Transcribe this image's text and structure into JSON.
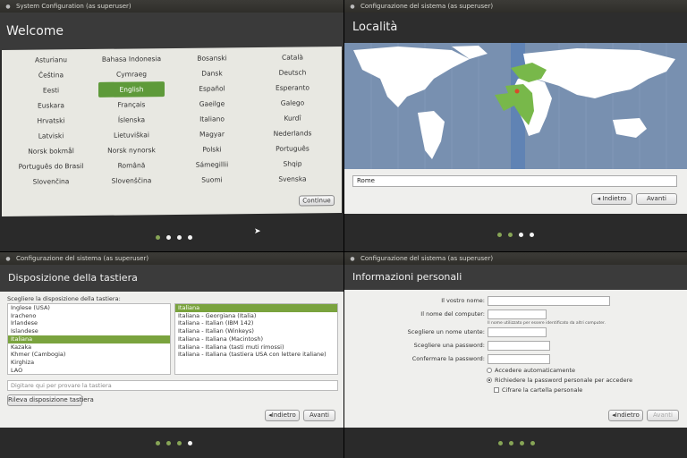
{
  "panel1": {
    "window_title": "System Configuration (as superuser)",
    "heading": "Welcome",
    "languages": [
      "Asturianu",
      "Bahasa Indonesia",
      "Bosanski",
      "Català",
      "Čeština",
      "Cymraeg",
      "Dansk",
      "Deutsch",
      "Eesti",
      "English",
      "Español",
      "Esperanto",
      "Euskara",
      "Français",
      "Gaeilge",
      "Galego",
      "Hrvatski",
      "Íslenska",
      "Italiano",
      "Kurdî",
      "Latviski",
      "Lietuviškai",
      "Magyar",
      "Nederlands",
      "Norsk bokmål",
      "Norsk nynorsk",
      "Polski",
      "Português",
      "Português do Brasil",
      "Română",
      "Sámegillii",
      "Shqip",
      "Slovenčina",
      "Slovenščina",
      "Suomi",
      "Svenska"
    ],
    "selected_language": "English",
    "continue_label": "Continue",
    "progress_step": 1,
    "progress_total": 4
  },
  "panel2": {
    "window_title": "Configurazione del sistema (as superuser)",
    "heading": "Località",
    "city_value": "Rome",
    "back_label": "Indietro",
    "next_label": "Avanti",
    "progress_step": 2,
    "progress_total": 4,
    "colors": {
      "ocean": "#7890b0",
      "land": "#ffffff",
      "selected_zone": "#78b84a",
      "timezone_band": "#5a7fb5"
    }
  },
  "panel3": {
    "window_title": "Configurazione del sistema (as superuser)",
    "heading": "Disposizione della tastiera",
    "choose_label": "Scegliere la disposizione della tastiera:",
    "layouts": [
      "Inglese (USA)",
      "Iracheno",
      "Irlandese",
      "Islandese",
      "Italiana",
      "Kazaka",
      "Khmer (Cambogia)",
      "Kirghiza",
      "LAO"
    ],
    "selected_layout": "Italiana",
    "variants": [
      "Italiana",
      "Italiana - Georgiana (Italia)",
      "Italiana - Italian (IBM 142)",
      "Italiana - Italian (Winkeys)",
      "Italiana - Italiana (Macintosh)",
      "Italiana - Italiana (tasti muti rimossi)",
      "Italiana - Italiana (tastiera USA con lettere italiane)"
    ],
    "selected_variant": "Italiana",
    "test_placeholder": "Digitare qui per provare la tastiera",
    "detect_label": "Rileva disposizione tastiera",
    "back_label": "Indietro",
    "next_label": "Avanti",
    "progress_step": 3,
    "progress_total": 4
  },
  "panel4": {
    "window_title": "Configurazione del sistema (as superuser)",
    "heading": "Informazioni personali",
    "name_label": "Il vostro nome:",
    "computer_label": "Il nome del computer:",
    "computer_hint": "Il nome utilizzato per essere identificato da altri computer.",
    "username_label": "Scegliere un nome utente:",
    "password_label": "Scegliere una password:",
    "confirm_label": "Confermare la password:",
    "auto_login": "Accedere automaticamente",
    "require_password": "Richiedere la password personale per accedere",
    "encrypt_home": "Cifrare la cartella personale",
    "back_label": "Indietro",
    "next_label": "Avanti",
    "progress_step": 4,
    "progress_total": 4
  }
}
